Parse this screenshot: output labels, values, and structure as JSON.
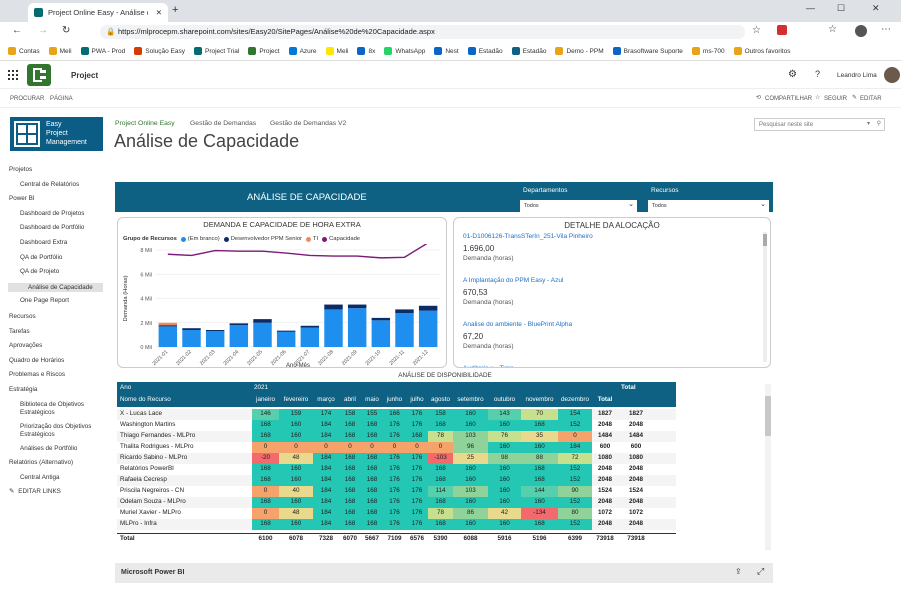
{
  "browser": {
    "tab_title": "Project Online Easy - Análise de",
    "url": "https://mlprocepm.sharepoint.com/sites/Easy20/SitePages/Análise%20de%20Capacidade.aspx",
    "bookmarks": [
      {
        "label": "Contas",
        "color": "#e8a317"
      },
      {
        "label": "Meli",
        "color": "#e8a317"
      },
      {
        "label": "PWA - Prod",
        "color": "#036c70"
      },
      {
        "label": "Solução Easy",
        "color": "#d83b01"
      },
      {
        "label": "Project Trial",
        "color": "#036c70"
      },
      {
        "label": "Project",
        "color": "#31752f"
      },
      {
        "label": "Azure",
        "color": "#0078d4"
      },
      {
        "label": "Meli",
        "color": "#ffe600"
      },
      {
        "label": "8x",
        "color": "#0a66c2"
      },
      {
        "label": "WhatsApp",
        "color": "#25d366"
      },
      {
        "label": "Nest",
        "color": "#0a66c2"
      },
      {
        "label": "Estadão",
        "color": "#0a66c2"
      },
      {
        "label": "Estadão",
        "color": "#0e6183"
      },
      {
        "label": "Demo - PPM",
        "color": "#e8a317"
      },
      {
        "label": "Brasoftware Suporte",
        "color": "#0a66c2"
      },
      {
        "label": "ms-700",
        "color": "#e8a317"
      },
      {
        "label": "Outros favoritos",
        "color": "#e8a317"
      }
    ]
  },
  "suite": {
    "app_name": "Project",
    "user_name": "Leandro Lima"
  },
  "command_bar": {
    "procurar": "PROCURAR",
    "pagina": "PÁGINA",
    "compartilhar": "COMPARTILHAR",
    "seguir": "SEGUIR",
    "editar": "EDITAR"
  },
  "site": {
    "logo_lines": [
      "Easy",
      "Project",
      "Management"
    ],
    "topnav": [
      "Project Online Easy",
      "Gestão de Demandas",
      "Gestão de Demandas V2"
    ],
    "page_title": "Análise de Capacidade",
    "search_placeholder": "Pesquisar neste site"
  },
  "leftnav": [
    {
      "label": "Projetos",
      "level": 0
    },
    {
      "label": "Central de Relatórios",
      "level": 1
    },
    {
      "label": "Power BI",
      "level": 0
    },
    {
      "label": "Dashboard de Projetos",
      "level": 1
    },
    {
      "label": "Dashboard de Portfólio",
      "level": 1
    },
    {
      "label": "Dashboard Extra",
      "level": 1
    },
    {
      "label": "QA de Portfólio",
      "level": 1
    },
    {
      "label": "QA de Projeto",
      "level": 1
    },
    {
      "label": "Análise de Capacidade",
      "level": 1,
      "selected": true
    },
    {
      "label": "One Page Report",
      "level": 1
    },
    {
      "label": "Recursos",
      "level": 0
    },
    {
      "label": "Tarefas",
      "level": 0
    },
    {
      "label": "Aprovações",
      "level": 0
    },
    {
      "label": "Quadro de Horários",
      "level": 0
    },
    {
      "label": "Problemas e Riscos",
      "level": 0
    },
    {
      "label": "Estratégia",
      "level": 0
    },
    {
      "label": "Biblioteca de Objetivos Estratégicos",
      "level": 1
    },
    {
      "label": "Priorização dos Objetivos Estratégicos",
      "level": 1
    },
    {
      "label": "Análises de Portfólio",
      "level": 1
    },
    {
      "label": "Relatórios (Alternativo)",
      "level": 0
    },
    {
      "label": "Central Antiga",
      "level": 1
    },
    {
      "label": "EDITAR LINKS",
      "level": 0,
      "edit": true
    }
  ],
  "report": {
    "banner_title": "ANÁLISE DE CAPACIDADE",
    "filter1": {
      "label": "Departamentos",
      "value": "Todos"
    },
    "filter2": {
      "label": "Recursos",
      "value": "Todos"
    },
    "detail_title": "DETALHE DA ALOCAÇÃO",
    "detail_items": [
      {
        "name": "01-D1006126-TransSTerIn_251-Vila Pinheiro",
        "value": "1.696,00",
        "unit": "Demanda (horas)"
      },
      {
        "name": "A Implantação do PPM Easy - Azul",
        "value": "670,53",
        "unit": "Demanda (horas)"
      },
      {
        "name": "Analise do ambiente - BluePrint Alpha",
        "value": "67,20",
        "unit": "Demanda (horas)"
      },
      {
        "name": "Auditoria x - Tigre",
        "value": "",
        "unit": ""
      }
    ],
    "matrix_title": "ANÁLISE DE DISPONIBILIDADE",
    "matrix": {
      "h_ano": "Ano",
      "h_year": "2021",
      "h_total": "Total",
      "h_nome": "Nome do Recurso",
      "months": [
        "janeiro",
        "fevereiro",
        "março",
        "abril",
        "maio",
        "junho",
        "julho",
        "agosto",
        "setembro",
        "outubro",
        "novembro",
        "dezembro",
        "Total"
      ],
      "rows": [
        {
          "name": "X - Lucas Lace",
          "vals": [
            "146",
            "159",
            "174",
            "158",
            "155",
            "166",
            "176",
            "158",
            "160",
            "143",
            "70",
            "154",
            "1827"
          ],
          "total": "1827"
        },
        {
          "name": "Washington Martins",
          "vals": [
            "168",
            "160",
            "184",
            "168",
            "168",
            "176",
            "176",
            "168",
            "160",
            "160",
            "168",
            "152",
            "2048"
          ],
          "total": "2048"
        },
        {
          "name": "Thiago Fernandes - MLPro",
          "vals": [
            "168",
            "160",
            "184",
            "168",
            "168",
            "176",
            "168",
            "78",
            "103",
            "76",
            "35",
            "0",
            "1484"
          ],
          "total": "1484"
        },
        {
          "name": "Thalita Rodrigues - MLPro",
          "vals": [
            "0",
            "0",
            "0",
            "0",
            "0",
            "0",
            "0",
            "0",
            "96",
            "160",
            "160",
            "184",
            "600"
          ],
          "total": "600"
        },
        {
          "name": "Ricardo Sabino - MLPro",
          "vals": [
            "-20",
            "48",
            "184",
            "168",
            "168",
            "176",
            "176",
            "-103",
            "25",
            "98",
            "88",
            "72",
            "1080"
          ],
          "total": "1080"
        },
        {
          "name": "Relatórios PowerBI",
          "vals": [
            "168",
            "160",
            "184",
            "168",
            "168",
            "176",
            "176",
            "168",
            "160",
            "160",
            "168",
            "152",
            "2048"
          ],
          "total": "2048"
        },
        {
          "name": "Rafaela Cecresp",
          "vals": [
            "168",
            "160",
            "184",
            "168",
            "168",
            "176",
            "176",
            "168",
            "160",
            "160",
            "168",
            "152",
            "2048"
          ],
          "total": "2048"
        },
        {
          "name": "Priscila Negreiros - CN",
          "vals": [
            "0",
            "40",
            "184",
            "168",
            "168",
            "176",
            "176",
            "114",
            "103",
            "160",
            "144",
            "90",
            "1524"
          ],
          "total": "1524"
        },
        {
          "name": "Odelam Souza - MLPro",
          "vals": [
            "168",
            "160",
            "184",
            "168",
            "168",
            "176",
            "176",
            "168",
            "160",
            "160",
            "160",
            "152",
            "2048"
          ],
          "total": "2048"
        },
        {
          "name": "Muriel Xavier - MLPro",
          "vals": [
            "0",
            "48",
            "184",
            "168",
            "168",
            "176",
            "176",
            "78",
            "86",
            "42",
            "-134",
            "80",
            "1072"
          ],
          "total": "1072"
        },
        {
          "name": "MLPro - Infra",
          "vals": [
            "168",
            "160",
            "184",
            "168",
            "168",
            "176",
            "176",
            "168",
            "160",
            "160",
            "168",
            "152",
            "2048"
          ],
          "total": "2048"
        }
      ],
      "footer": {
        "label": "Total",
        "vals": [
          "6100",
          "6078",
          "7328",
          "6070",
          "5667",
          "7109",
          "6576",
          "5390",
          "6088",
          "5916",
          "5196",
          "6399",
          "73918"
        ],
        "total": "73918"
      }
    },
    "footer_bar": "Microsoft Power BI"
  },
  "chart_data": {
    "type": "bar",
    "title": "DEMANDA E CAPACIDADE DE HORA EXTRA",
    "legend_title": "Grupo de Recursos",
    "legend": [
      {
        "name": "(Em branco)",
        "color": "#1f8fef"
      },
      {
        "name": "Desenvolvedor PPM Senior",
        "color": "#0b2c66"
      },
      {
        "name": "TI",
        "color": "#f08a5d"
      },
      {
        "name": "Capacidade",
        "color": "#7b1a78"
      }
    ],
    "ylabel": "Demanda (Horas)",
    "xlabel": "Ano-Mês",
    "categories": [
      "2021-01",
      "2021-02",
      "2021-03",
      "2021-04",
      "2021-05",
      "2021-06",
      "2021-07",
      "2021-08",
      "2021-09",
      "2021-10",
      "2021-11",
      "2021-12"
    ],
    "yticks": [
      "0 Mil",
      "2 Mil",
      "4 Mil",
      "6 Mil",
      "8 Mil"
    ],
    "ylim": [
      0,
      8000
    ],
    "series": [
      {
        "name": "(Em branco)",
        "type": "bar",
        "values": [
          1700,
          1400,
          1300,
          1800,
          2000,
          1250,
          1600,
          3100,
          3200,
          2200,
          2800,
          3000
        ]
      },
      {
        "name": "Desenvolvedor PPM Senior",
        "type": "bar",
        "values": [
          100,
          150,
          100,
          150,
          300,
          100,
          150,
          400,
          300,
          200,
          300,
          400
        ]
      },
      {
        "name": "TI",
        "type": "bar",
        "values": [
          200,
          0,
          0,
          0,
          0,
          0,
          0,
          0,
          0,
          0,
          0,
          0
        ]
      },
      {
        "name": "Capacidade",
        "type": "line",
        "values": [
          7650,
          7550,
          7950,
          7900,
          7900,
          7750,
          7550,
          7500,
          7500,
          7350,
          7400,
          8600
        ]
      }
    ]
  }
}
